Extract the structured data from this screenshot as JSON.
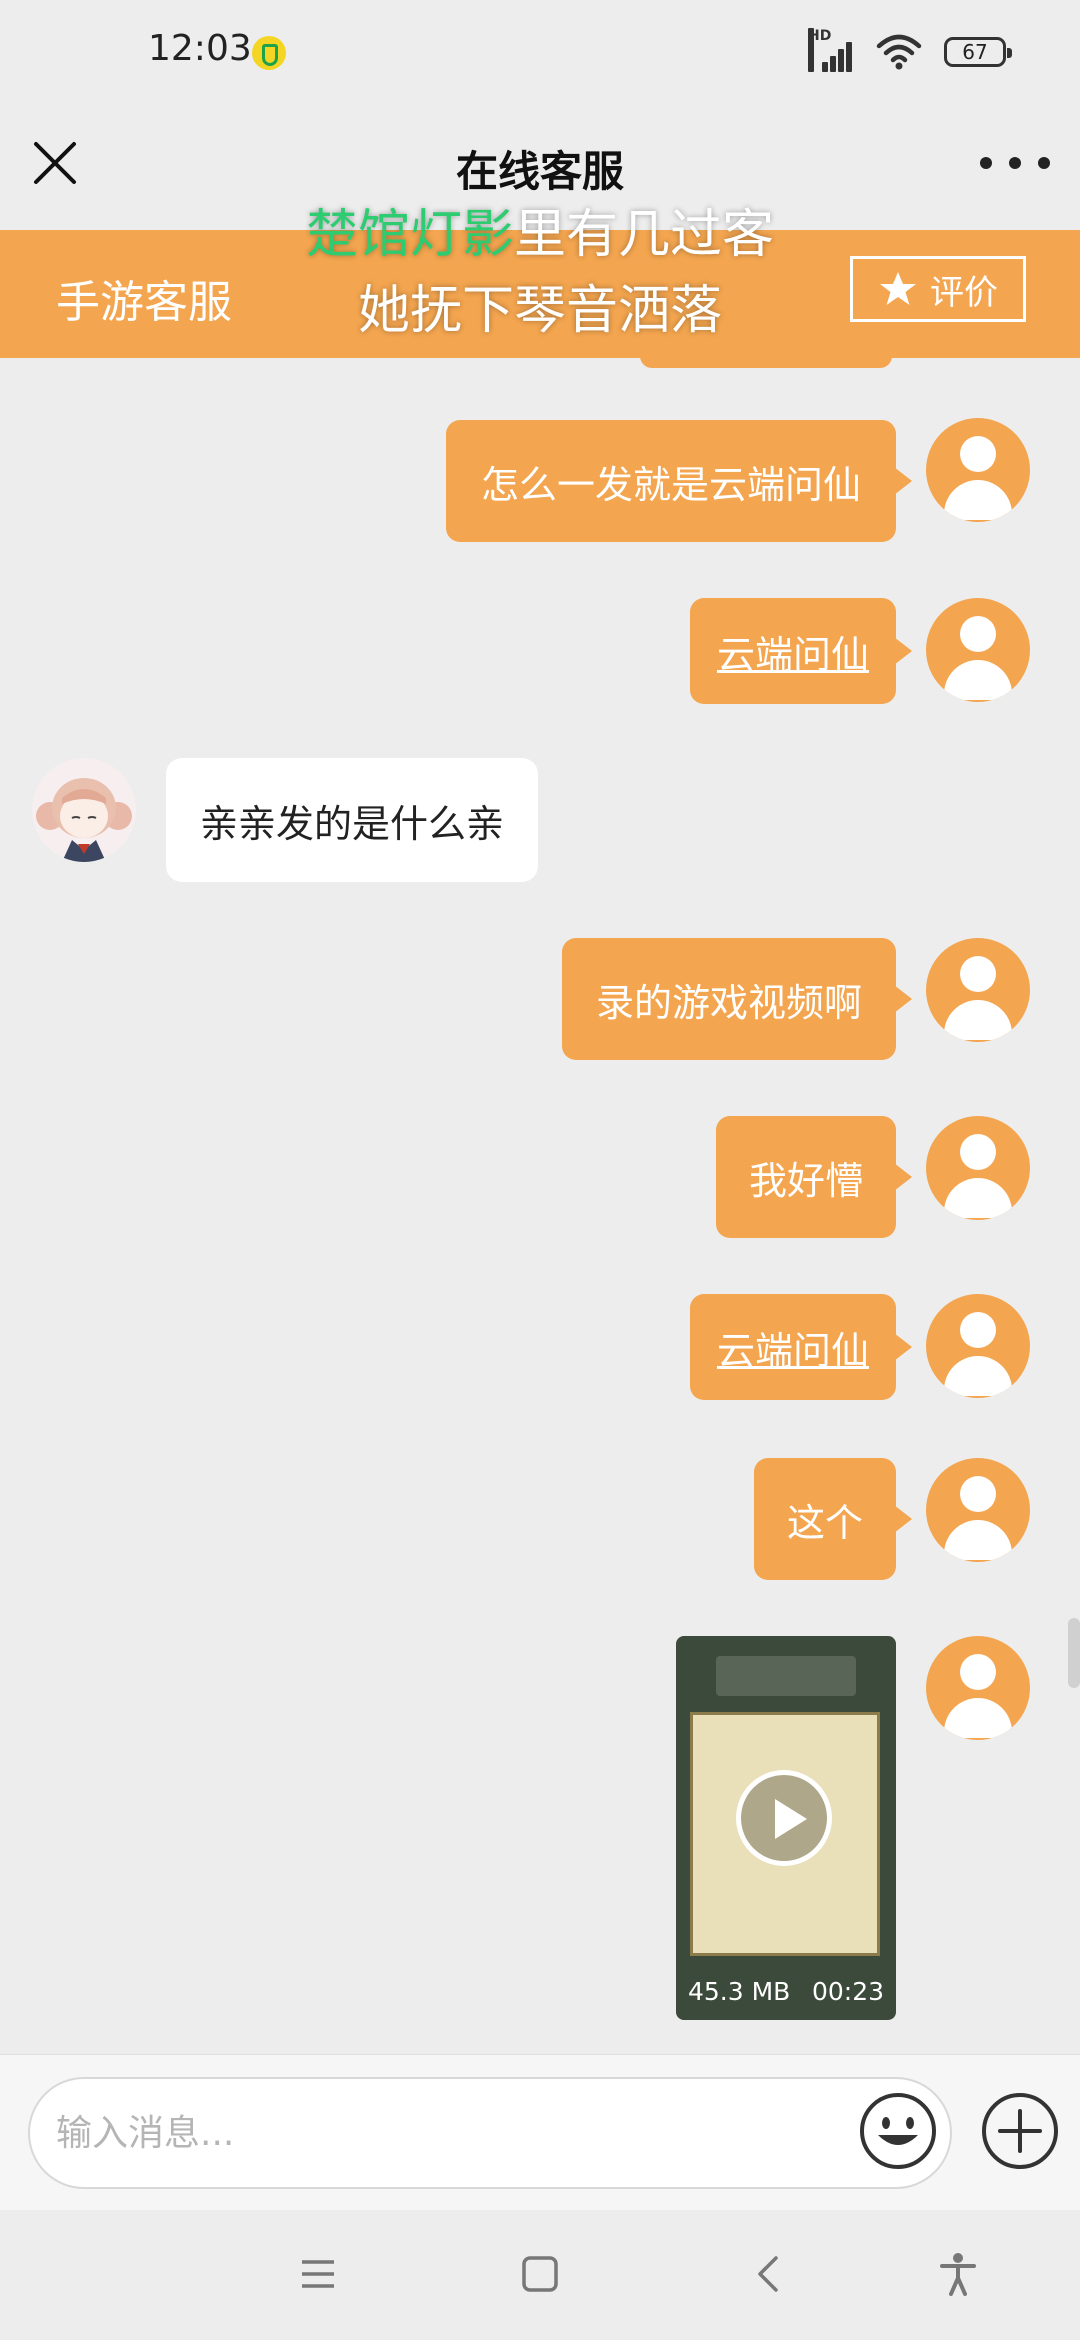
{
  "status_bar": {
    "time": "12:03",
    "network_label": "HD",
    "battery_level": "67",
    "icons": [
      "music-app-icon",
      "signal-icon",
      "wifi-icon",
      "battery-icon"
    ]
  },
  "nav": {
    "title": "在线客服",
    "close_icon": "close-icon",
    "more_icon": "more-icon"
  },
  "service_header": {
    "name": "手游客服",
    "rate_label": "评价",
    "rate_icon": "star-icon"
  },
  "lyrics": {
    "line1_highlighted": "楚馆灯影",
    "line1_rest": "里有几过客",
    "line2": "她抚下琴音洒落"
  },
  "messages": [
    {
      "side": "out",
      "type": "text",
      "text": "怎么一发就是云端问仙"
    },
    {
      "side": "out",
      "type": "link",
      "text": "云端问仙"
    },
    {
      "side": "in",
      "type": "text",
      "text": "亲亲发的是什么亲"
    },
    {
      "side": "out",
      "type": "text",
      "text": "录的游戏视频啊"
    },
    {
      "side": "out",
      "type": "text",
      "text": "我好懵"
    },
    {
      "side": "out",
      "type": "link",
      "text": "云端问仙"
    },
    {
      "side": "out",
      "type": "text",
      "text": "这个"
    },
    {
      "side": "out",
      "type": "video",
      "size": "45.3 MB",
      "duration": "00:23"
    }
  ],
  "input": {
    "placeholder": "输入消息..."
  },
  "colors": {
    "accent": "#f3a54f",
    "background": "#ededed",
    "lyric_highlight": "#2ecc71"
  }
}
